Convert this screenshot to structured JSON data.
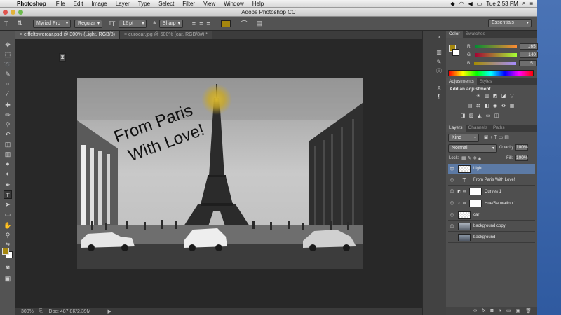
{
  "menubar": {
    "app": "Photoshop",
    "items": [
      "File",
      "Edit",
      "Image",
      "Layer",
      "Type",
      "Select",
      "Filter",
      "View",
      "Window",
      "Help"
    ],
    "time": "Tue 2:53 PM"
  },
  "window": {
    "title": "Adobe Photoshop CC"
  },
  "options": {
    "font_family": "Myriad Pro",
    "font_style": "Regular",
    "font_size": "12 pt",
    "antialias": "Sharp",
    "workspace": "Essentials",
    "text_color": "#a5870f"
  },
  "doc_tabs": [
    {
      "label": "eiffeltowercar.psd @ 300% (Light, RGB/8)"
    },
    {
      "label": "eurocar.jpg @ 500% (car, RGB/8#) *"
    }
  ],
  "image": {
    "text_line1": "From Paris",
    "text_line2": "With Love!"
  },
  "status": {
    "zoom": "300%",
    "doc": "Doc: 487.8K/2.39M"
  },
  "color_panel": {
    "tabs": [
      "Color",
      "Swatches"
    ],
    "r_label": "R",
    "g_label": "G",
    "b_label": "B",
    "r": "165",
    "g": "140",
    "b": "51"
  },
  "adjustments_panel": {
    "tabs": [
      "Adjustments",
      "Styles"
    ],
    "heading": "Add an adjustment"
  },
  "layers_panel": {
    "tabs": [
      "Layers",
      "Channels",
      "Paths"
    ],
    "kind": "Kind",
    "blend": "Normal",
    "opacity_label": "Opacity:",
    "opacity": "100%",
    "lock_label": "Lock:",
    "fill_label": "Fill:",
    "fill": "100%",
    "layers": [
      {
        "name": "Light"
      },
      {
        "name": "From Paris With Love!"
      },
      {
        "name": "Curves 1"
      },
      {
        "name": "Hue/Saturation 1"
      },
      {
        "name": "car"
      },
      {
        "name": "background copy"
      },
      {
        "name": "background"
      }
    ]
  }
}
